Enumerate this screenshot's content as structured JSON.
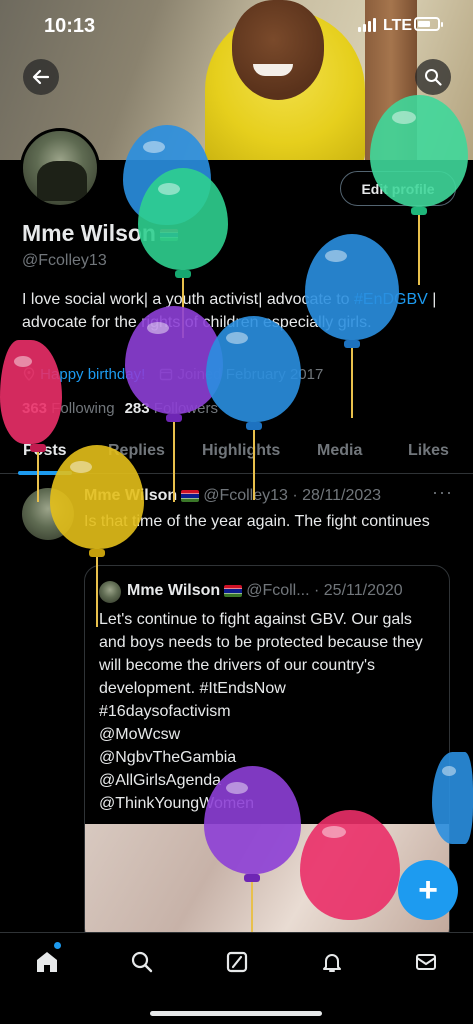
{
  "status_bar": {
    "time": "10:13",
    "network": "LTE"
  },
  "header": {
    "back_icon": "arrow-left-icon",
    "search_icon": "search-icon"
  },
  "profile": {
    "edit_label": "Edit profile",
    "name": "Mme Wilson",
    "handle": "@Fcolley13",
    "bio_part1": "I love social work| a youth activist| advocate to ",
    "bio_hashtag": "#EnDGBV",
    "bio_part2": " | advocate for the rights of children especially girls.",
    "birthday": "Happy birthday!",
    "joined": "Joined February 2017",
    "following_count": "363",
    "following_label": "Following",
    "followers_count": "283",
    "followers_label": "Followers"
  },
  "tabs": [
    {
      "label": "Posts",
      "active": true
    },
    {
      "label": "Replies"
    },
    {
      "label": "Highlights"
    },
    {
      "label": "Media"
    },
    {
      "label": "Likes"
    }
  ],
  "post": {
    "author": "Mme Wilson",
    "handle_date": "@Fcolley13 · 28/11/2023",
    "more": "···",
    "text": "Is that time of the year again. The fight continues",
    "quote": {
      "author": "Mme Wilson",
      "handle_date": "@Fcoll... · 25/11/2020",
      "lines": [
        "Let's continue to fight against GBV. Our gals and boys needs to be protected because they will become the drivers of our country's development. #ItEndsNow",
        "#16daysofactivism",
        "@MoWcsw",
        "@NgbvTheGambia",
        "@AllGirlsAgenda",
        "@ThinkYoungWomen"
      ]
    }
  },
  "fab": {
    "label": "+"
  },
  "bottom_nav": [
    "home-icon",
    "search-icon",
    "grok-icon",
    "bell-icon",
    "mail-icon"
  ],
  "colors": {
    "accent": "#1d9bf0",
    "background": "#000000",
    "muted": "#71767b"
  }
}
